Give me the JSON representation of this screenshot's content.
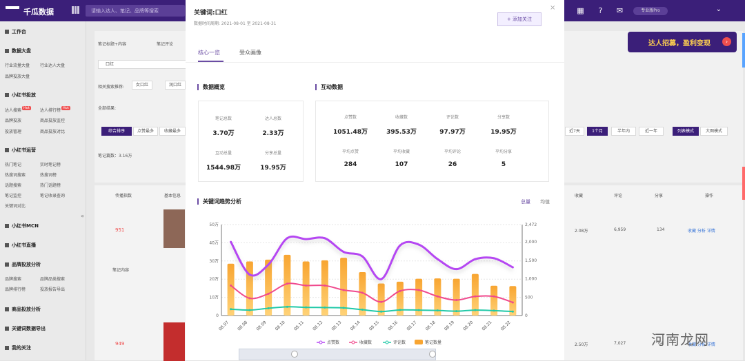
{
  "app": {
    "title": "千瓜数据",
    "search_placeholder": "请输入达人、笔记、品牌等搜索",
    "vip_label": "专业版Pro"
  },
  "sidebar": {
    "workspace": "工作台",
    "groups": [
      {
        "title": "数据大盘",
        "items": [
          "行业流量大盘",
          "行业达人大盘",
          "品牌投放大盘"
        ]
      },
      {
        "title": "小红书投放",
        "items": [
          "达人搜索",
          "达人排行榜",
          "品牌投放",
          "商品投放监控",
          "投放管理",
          "商品投放对比"
        ]
      },
      {
        "title": "小红书运营",
        "items": [
          "热门笔记",
          "实时笔记榜",
          "热搜词搜索",
          "热搜词榜",
          "话题搜索",
          "热门话题榜",
          "笔记监控",
          "笔记收录查询",
          "关键词对比"
        ]
      },
      {
        "title": "小红书MCN",
        "items": []
      },
      {
        "title": "小红书直播",
        "items": []
      },
      {
        "title": "品牌投放分析",
        "items": [
          "品牌搜索",
          "品牌品类搜索",
          "品牌排行榜",
          "投放报告导出"
        ]
      },
      {
        "title": "商品投放分析",
        "items": []
      },
      {
        "title": "关键词数据导出",
        "items": []
      },
      {
        "title": "我的关注",
        "items": []
      }
    ],
    "hot_label": "Hot"
  },
  "background": {
    "banner_text": "达人招募，盈利变现",
    "radio_1": "笔记标题+内容",
    "radio_2": "笔记评论",
    "keyword": "口红",
    "related_label": "相关搜索推荐:",
    "related_tags": [
      "女口红",
      "润口红"
    ],
    "filter_label": "全部结果:",
    "sort_tabs": [
      "综合排序",
      "点赞最多",
      "收藏最多"
    ],
    "time_tabs": [
      "近7天",
      "1个月",
      "半年内",
      "近一年"
    ],
    "view_tabs": [
      "列表模式",
      "大图模式"
    ],
    "note_count": "笔记篇数：3.16万",
    "table_headers": [
      "传播指数",
      "基本信息",
      "收藏",
      "评论",
      "分享",
      "操作"
    ],
    "rows": [
      {
        "score": "951",
        "collect": "2.08万",
        "comment": "6,959",
        "share": "134",
        "actions": "收藏 分析 详情"
      },
      {
        "score": "949",
        "collect": "2.50万",
        "comment": "7,027",
        "share": "64",
        "actions": "收藏 分析 详情"
      }
    ],
    "note_label": "笔记内容",
    "watermark": "河南龙网"
  },
  "modal": {
    "title": "关键词:口红",
    "subtitle": "数据时间周期: 2021-08-01 至 2021-08-31",
    "follow_button": "+ 添加关注",
    "tabs": [
      "核心一览",
      "受众画像"
    ],
    "overview_title": "数据概览",
    "interaction_title": "互动数据",
    "overview_metrics": [
      {
        "label": "笔记总数",
        "value": "3.70万"
      },
      {
        "label": "达人总数",
        "value": "2.33万"
      },
      {
        "label": "互动总量",
        "value": "1544.98万"
      },
      {
        "label": "分享总量",
        "value": "19.95万"
      }
    ],
    "interaction_metrics": [
      {
        "label": "点赞数",
        "value": "1051.48万"
      },
      {
        "label": "收藏数",
        "value": "395.53万"
      },
      {
        "label": "评论数",
        "value": "97.97万"
      },
      {
        "label": "分享数",
        "value": "19.95万"
      },
      {
        "label": "平均点赞",
        "value": "284"
      },
      {
        "label": "平均收藏",
        "value": "107"
      },
      {
        "label": "平均评论",
        "value": "26"
      },
      {
        "label": "平均分享",
        "value": "5"
      }
    ],
    "trend_title": "关键词趋势分析",
    "toggle_total": "总量",
    "toggle_average": "均值",
    "legend": [
      "点赞数",
      "收藏数",
      "评论数",
      "笔记数量"
    ]
  },
  "chart_data": {
    "type": "bar",
    "categories": [
      "08.07",
      "08.08",
      "08.09",
      "08.10",
      "08.11",
      "08.12",
      "08.13",
      "08.14",
      "08.15",
      "08.16",
      "08.17",
      "08.18",
      "08.19",
      "08.20",
      "08.21",
      "08.22"
    ],
    "left_axis": {
      "ticks": [
        "0",
        "10万",
        "20万",
        "30万",
        "40万",
        "50万"
      ],
      "range": [
        0,
        500000
      ]
    },
    "right_axis": {
      "ticks": [
        "0",
        "500",
        "1,000",
        "1,500",
        "2,000",
        "2,472"
      ],
      "range": [
        0,
        2472
      ]
    },
    "series": [
      {
        "name": "笔记数量",
        "axis": "right",
        "type": "bar",
        "values": [
          1410,
          1470,
          1520,
          1650,
          1470,
          1500,
          1570,
          1180,
          870,
          920,
          1000,
          1010,
          1000,
          1130,
          810,
          800
        ]
      },
      {
        "name": "点赞数",
        "axis": "left",
        "type": "line",
        "values": [
          405000,
          225000,
          280000,
          425000,
          420000,
          425000,
          350000,
          325000,
          200000,
          385000,
          390000,
          310000,
          255000,
          310000,
          315000,
          265000
        ]
      },
      {
        "name": "收藏数",
        "axis": "left",
        "type": "line",
        "values": [
          165000,
          95000,
          120000,
          175000,
          165000,
          165000,
          140000,
          125000,
          75000,
          135000,
          140000,
          105000,
          85000,
          105000,
          105000,
          72000
        ]
      },
      {
        "name": "评论数",
        "axis": "left",
        "type": "line",
        "values": [
          35000,
          30000,
          40000,
          48000,
          45000,
          44000,
          42000,
          32000,
          22000,
          31000,
          30000,
          28000,
          24000,
          30000,
          27000,
          22000
        ]
      }
    ],
    "colors": {
      "likes": "#b546f2",
      "collects": "#f0498d",
      "comments": "#20c9a8",
      "notes": "#f8a531"
    }
  }
}
